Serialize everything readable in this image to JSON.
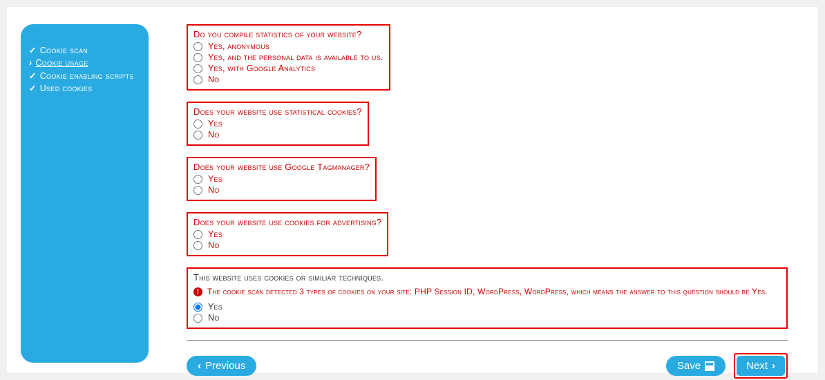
{
  "sidebar": {
    "items": [
      {
        "icon": "✓",
        "label": "Cookie scan"
      },
      {
        "icon": "›",
        "label": "Cookie usage"
      },
      {
        "icon": "✓",
        "label": "Cookie enabling scripts"
      },
      {
        "icon": "✓",
        "label": "Used cookies"
      }
    ]
  },
  "questions": {
    "q1": {
      "title": "Do you compile statistics of your website?",
      "options": [
        "Yes, anonymous",
        "Yes, and the personal data is available to us.",
        "Yes, with Google Analytics",
        "No"
      ]
    },
    "q2": {
      "title": "Does your website use statistical cookies?",
      "options": [
        "Yes",
        "No"
      ]
    },
    "q3": {
      "title": "Does your website use Google Tagmanager?",
      "options": [
        "Yes",
        "No"
      ]
    },
    "q4": {
      "title": "Does your website use cookies for advertising?",
      "options": [
        "Yes",
        "No"
      ]
    },
    "q5": {
      "title": "This website uses cookies or similiar techniques.",
      "alert": "The cookie scan detected 3 types of cookies on your site: PHP Session ID, WordPress, WordPress, which means the answer to this question should be Yes.",
      "options": [
        "Yes",
        "No"
      ]
    }
  },
  "footer": {
    "previous": "Previous",
    "save": "Save",
    "next": "Next"
  }
}
